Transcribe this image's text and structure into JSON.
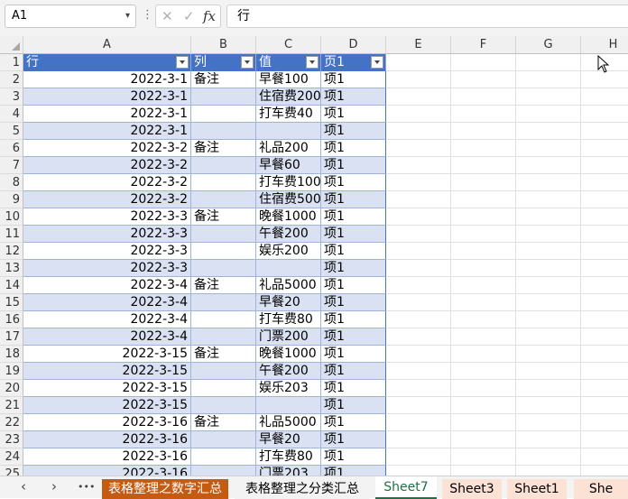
{
  "formula_bar": {
    "name_box": "A1",
    "more": "⋮",
    "cancel_glyph": "✕",
    "confirm_glyph": "✓",
    "fx_label": "fx",
    "formula": "行"
  },
  "columns": [
    "A",
    "B",
    "C",
    "D",
    "E",
    "F",
    "G",
    "H"
  ],
  "table_header": [
    "行",
    "列",
    "值",
    "页1"
  ],
  "rows": [
    [
      "2022-3-1",
      "备注",
      "早餐100",
      "项1"
    ],
    [
      "2022-3-1",
      "",
      "住宿费200",
      "项1"
    ],
    [
      "2022-3-1",
      "",
      "打车费40",
      "项1"
    ],
    [
      "2022-3-1",
      "",
      "",
      "项1"
    ],
    [
      "2022-3-2",
      "备注",
      "礼品200",
      "项1"
    ],
    [
      "2022-3-2",
      "",
      "早餐60",
      "项1"
    ],
    [
      "2022-3-2",
      "",
      "打车费100",
      "项1"
    ],
    [
      "2022-3-2",
      "",
      "住宿费500",
      "项1"
    ],
    [
      "2022-3-3",
      "备注",
      "晚餐1000",
      "项1"
    ],
    [
      "2022-3-3",
      "",
      "午餐200",
      "项1"
    ],
    [
      "2022-3-3",
      "",
      "娱乐200",
      "项1"
    ],
    [
      "2022-3-3",
      "",
      "",
      "项1"
    ],
    [
      "2022-3-4",
      "备注",
      "礼品5000",
      "项1"
    ],
    [
      "2022-3-4",
      "",
      "早餐20",
      "项1"
    ],
    [
      "2022-3-4",
      "",
      "打车费80",
      "项1"
    ],
    [
      "2022-3-4",
      "",
      "门票200",
      "项1"
    ],
    [
      "2022-3-15",
      "备注",
      "晚餐1000",
      "项1"
    ],
    [
      "2022-3-15",
      "",
      "午餐200",
      "项1"
    ],
    [
      "2022-3-15",
      "",
      "娱乐203",
      "项1"
    ],
    [
      "2022-3-15",
      "",
      "",
      "项1"
    ],
    [
      "2022-3-16",
      "备注",
      "礼品5000",
      "项1"
    ],
    [
      "2022-3-16",
      "",
      "早餐20",
      "项1"
    ],
    [
      "2022-3-16",
      "",
      "打车费80",
      "项1"
    ],
    [
      "2022-3-16",
      "",
      "门票203",
      "项1"
    ]
  ],
  "row_numbers": [
    "1",
    "2",
    "3",
    "4",
    "5",
    "6",
    "7",
    "8",
    "9",
    "10",
    "11",
    "12",
    "13",
    "14",
    "15",
    "16",
    "17",
    "18",
    "19",
    "20",
    "21",
    "22",
    "23",
    "24",
    "25"
  ],
  "tabs": [
    {
      "label": "表格整理之数字汇总",
      "bg": "#c55a11",
      "color": "#ffffff"
    },
    {
      "label": "表格整理之分类汇总",
      "bg": "#f3f3f3",
      "color": "#000000"
    },
    {
      "label": "Sheet7",
      "bg": "#ffffff",
      "color": "#1e7145",
      "active": true
    },
    {
      "label": "Sheet3",
      "bg": "#fbe2d5",
      "color": "#000000"
    },
    {
      "label": "Sheet1",
      "bg": "#fbe2d5",
      "color": "#000000"
    },
    {
      "label": "She",
      "bg": "#fbe2d5",
      "color": "#000000"
    }
  ],
  "tab_nav": {
    "prev": "‹",
    "next": "›",
    "more": "•••"
  },
  "colors": {
    "table_header": "#4472c4",
    "band": "#d9e1f2",
    "active_tab_underline": "#1e7145"
  }
}
